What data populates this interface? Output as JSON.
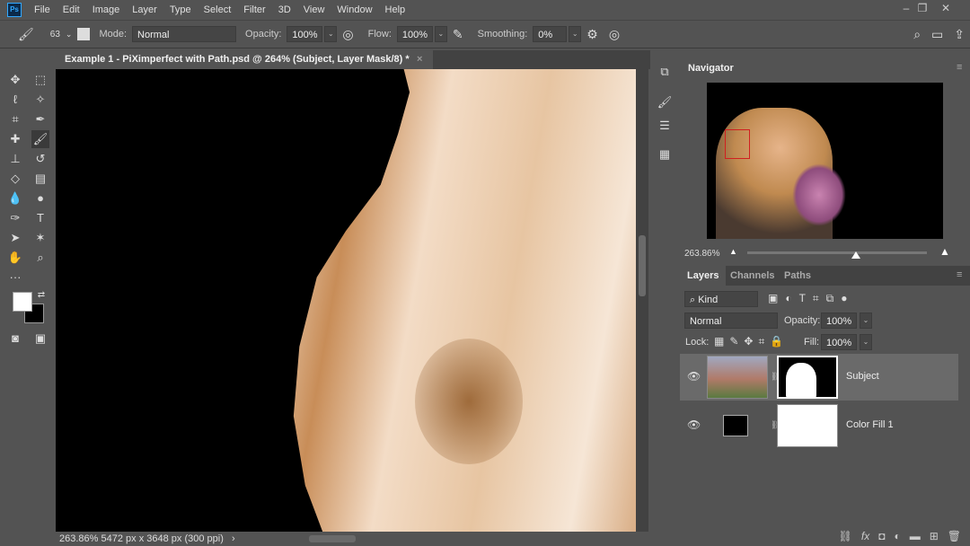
{
  "app": {
    "logo": "Ps",
    "menu": [
      "File",
      "Edit",
      "Image",
      "Layer",
      "Type",
      "Select",
      "Filter",
      "3D",
      "View",
      "Window",
      "Help"
    ]
  },
  "options": {
    "brush_size": "63",
    "mode_label": "Mode:",
    "mode": "Normal",
    "opacity_label": "Opacity:",
    "opacity": "100%",
    "flow_label": "Flow:",
    "flow": "100%",
    "smoothing_label": "Smoothing:",
    "smoothing": "0%"
  },
  "document": {
    "tab_title": "Example 1 - PiXimperfect with Path.psd @ 264% (Subject, Layer Mask/8) *",
    "close": "×"
  },
  "status": {
    "zoom": "263.86%",
    "size": "5472 px x 3648 px (300 ppi)",
    "arrow": "›"
  },
  "navigator": {
    "title": "Navigator",
    "zoom": "263.86%"
  },
  "layers_panel": {
    "tabs": [
      "Layers",
      "Channels",
      "Paths"
    ],
    "filter": "Kind",
    "blend": "Normal",
    "opacity_label": "Opacity:",
    "opacity": "100%",
    "lock_label": "Lock:",
    "fill_label": "Fill:",
    "fill": "100%",
    "layers": [
      {
        "name": "Subject",
        "selected": true
      },
      {
        "name": "Color Fill 1",
        "selected": false
      }
    ]
  },
  "colors": {
    "foreground": "#ffffff",
    "background": "#000000",
    "accent": "#31a8ff"
  }
}
